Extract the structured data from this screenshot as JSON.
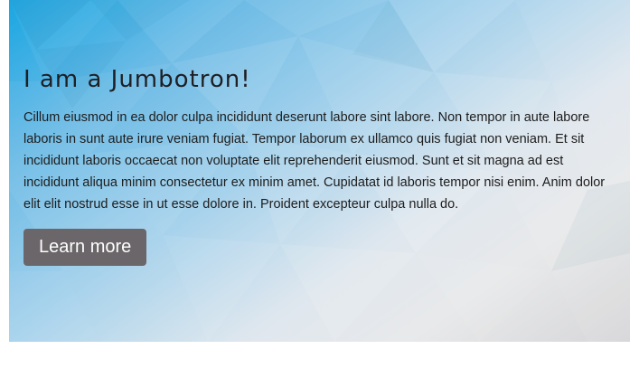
{
  "jumbotron": {
    "title": "I am a Jumbotron!",
    "body": "Cillum eiusmod in ea dolor culpa incididunt deserunt labore sint labore. Non tempor in aute labore laboris in sunt aute irure veniam fugiat. Tempor laborum ex ullamco quis fugiat non veniam. Et sit incididunt laboris occaecat non voluptate elit reprehenderit eiusmod. Sunt et sit magna ad est incididunt aliqua minim consectetur ex minim amet. Cupidatat id laboris tempor nisi enim. Anim dolor elit elit nostrud esse in ut esse dolore in. Proident excepteur culpa nulla do.",
    "button_label": "Learn more"
  },
  "colors": {
    "accent_blue": "#19a6e2",
    "button_bg": "#6b6669",
    "button_text": "#ffffff",
    "text": "#1d1d1d"
  }
}
